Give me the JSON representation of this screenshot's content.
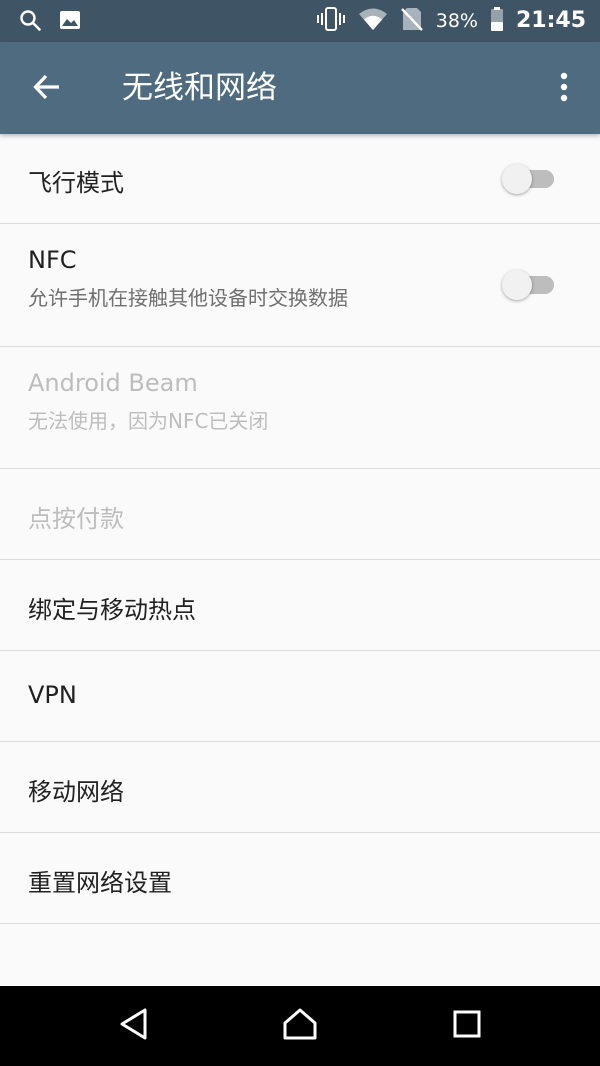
{
  "status_bar": {
    "battery_percent": "38%",
    "time": "21:45",
    "icons": [
      "search-icon",
      "image-icon",
      "vibrate-icon",
      "wifi-icon",
      "no-sim-icon",
      "battery-icon"
    ]
  },
  "app_bar": {
    "title": "无线和网络",
    "back_icon": "arrow-left-icon",
    "more_icon": "more-vert-icon"
  },
  "settings": [
    {
      "title": "飞行模式",
      "summary": "",
      "toggle": true,
      "on": false,
      "enabled": true
    },
    {
      "title": "NFC",
      "summary": "允许手机在接触其他设备时交换数据",
      "toggle": true,
      "on": false,
      "enabled": true
    },
    {
      "title": "Android Beam",
      "summary": "无法使用，因为NFC已关闭",
      "toggle": false,
      "enabled": false
    },
    {
      "title": "点按付款",
      "summary": "",
      "toggle": false,
      "enabled": false
    },
    {
      "title": "绑定与移动热点",
      "summary": "",
      "toggle": false,
      "enabled": true
    },
    {
      "title": "VPN",
      "summary": "",
      "toggle": false,
      "enabled": true
    },
    {
      "title": "移动网络",
      "summary": "",
      "toggle": false,
      "enabled": true
    },
    {
      "title": "重置网络设置",
      "summary": "",
      "toggle": false,
      "enabled": true
    }
  ],
  "nav_bar": {
    "icons": [
      "back-triangle-icon",
      "home-icon",
      "recents-icon"
    ]
  },
  "colors": {
    "status_bar": "#3f5566",
    "app_bar": "#4f6b80",
    "background": "#fafafa",
    "divider": "#dcdcdc",
    "disabled_text": "#bdbdbd"
  }
}
